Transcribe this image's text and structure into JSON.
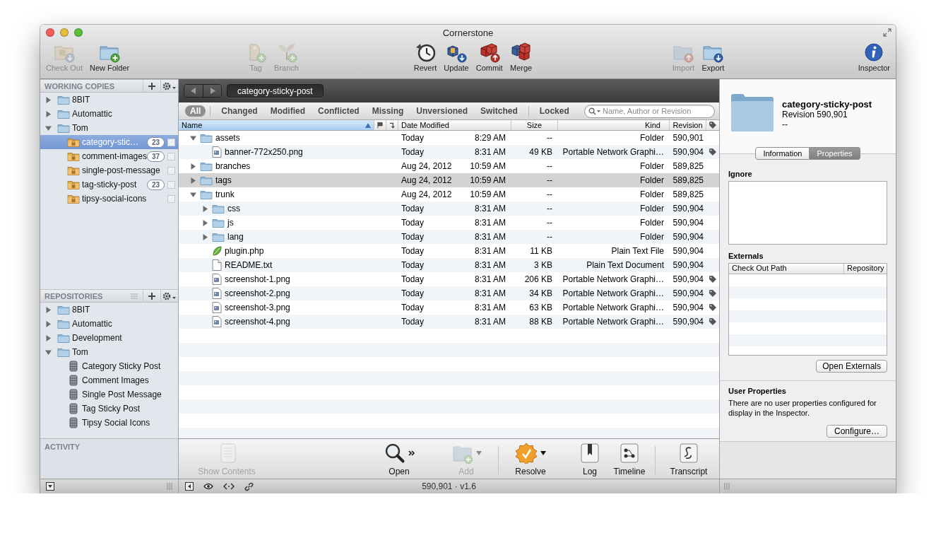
{
  "window": {
    "title": "Cornerstone"
  },
  "toolbar": {
    "groups": [
      [
        {
          "label": "Check Out",
          "kind": "checkout",
          "disabled": true
        },
        {
          "label": "New Folder",
          "kind": "new-folder",
          "disabled": false
        }
      ],
      [
        {
          "label": "Tag",
          "kind": "tag",
          "disabled": true
        },
        {
          "label": "Branch",
          "kind": "branch",
          "disabled": true
        }
      ],
      [
        {
          "label": "Revert",
          "kind": "revert",
          "disabled": false
        },
        {
          "label": "Update",
          "kind": "update",
          "disabled": false
        },
        {
          "label": "Commit",
          "kind": "commit",
          "disabled": false
        },
        {
          "label": "Merge",
          "kind": "merge",
          "disabled": false
        }
      ],
      [
        {
          "label": "Import",
          "kind": "import",
          "disabled": true
        },
        {
          "label": "Export",
          "kind": "export",
          "disabled": false
        }
      ],
      [
        {
          "label": "Inspector",
          "kind": "inspector",
          "disabled": false
        }
      ]
    ]
  },
  "working_copies": {
    "title": "WORKING COPIES",
    "items": [
      {
        "label": "8BIT",
        "kind": "folder",
        "expanded": false,
        "selected": false
      },
      {
        "label": "Automattic",
        "kind": "folder",
        "expanded": false,
        "selected": false
      },
      {
        "label": "Tom",
        "kind": "folder",
        "expanded": true,
        "selected": false,
        "children": [
          {
            "label": "category-stic…",
            "kind": "working-copy",
            "badge": "23",
            "checked": false,
            "selected": true
          },
          {
            "label": "comment-images",
            "kind": "working-copy",
            "badge": "37",
            "checked": false,
            "selected": false
          },
          {
            "label": "single-post-message",
            "kind": "working-copy",
            "checked": false,
            "selected": false
          },
          {
            "label": "tag-sticky-post",
            "kind": "working-copy",
            "badge": "23",
            "checked": false,
            "selected": false
          },
          {
            "label": "tipsy-social-icons",
            "kind": "working-copy",
            "checked": false,
            "selected": false
          }
        ]
      }
    ]
  },
  "repositories": {
    "title": "REPOSITORIES",
    "items": [
      {
        "label": "8BIT",
        "kind": "folder",
        "expanded": false,
        "selected": false
      },
      {
        "label": "Automattic",
        "kind": "folder",
        "expanded": false,
        "selected": false
      },
      {
        "label": "Development",
        "kind": "folder",
        "expanded": false,
        "selected": false
      },
      {
        "label": "Tom",
        "kind": "folder",
        "expanded": true,
        "selected": false,
        "children": [
          {
            "label": "Category Sticky Post",
            "kind": "repository",
            "selected": false
          },
          {
            "label": "Comment Images",
            "kind": "repository",
            "selected": false
          },
          {
            "label": "Single Post Message",
            "kind": "repository",
            "selected": false
          },
          {
            "label": "Tag Sticky Post",
            "kind": "repository",
            "selected": false
          },
          {
            "label": "Tipsy Social Icons",
            "kind": "repository",
            "selected": false
          }
        ]
      }
    ]
  },
  "activity": {
    "title": "ACTIVITY"
  },
  "browser": {
    "path": "category-sticky-post",
    "filters": [
      {
        "label": "All",
        "selected": true
      },
      {
        "label": "Changed",
        "selected": false
      },
      {
        "label": "Modified",
        "selected": false
      },
      {
        "label": "Conflicted",
        "selected": false
      },
      {
        "label": "Missing",
        "selected": false
      },
      {
        "label": "Unversioned",
        "selected": false
      },
      {
        "label": "Switched",
        "selected": false
      },
      {
        "label": "Locked",
        "selected": false
      }
    ],
    "search": {
      "placeholder": "Name, Author or Revision"
    },
    "columns": [
      {
        "kind": "text",
        "label": "Name",
        "sorted": true
      },
      {
        "kind": "flag",
        "sorted": false
      },
      {
        "kind": "arrow",
        "sorted": false
      },
      {
        "kind": "text",
        "label": "Date Modified",
        "sorted": false
      },
      {
        "kind": "text",
        "label": "Size",
        "sorted": false
      },
      {
        "kind": "text",
        "label": "Kind",
        "sorted": false
      },
      {
        "kind": "text",
        "label": "Revision",
        "sorted": false
      },
      {
        "kind": "tag",
        "sorted": false
      }
    ],
    "rows": [
      {
        "name": "assets",
        "kind": "folder",
        "expanded": true,
        "selected": false,
        "date": "Today",
        "time": "8:29 AM",
        "size": "--",
        "file_kind": "Folder",
        "revision": "590,901",
        "tagged": false,
        "children": [
          {
            "name": "banner-772x250.png",
            "kind": "image",
            "selected": false,
            "date": "Today",
            "time": "8:31 AM",
            "size": "49 KB",
            "file_kind": "Portable Network Graphi…",
            "revision": "590,904",
            "tagged": true
          }
        ]
      },
      {
        "name": "branches",
        "kind": "folder",
        "expanded": false,
        "selected": false,
        "date": "Aug 24, 2012",
        "time": "10:59 AM",
        "size": "--",
        "file_kind": "Folder",
        "revision": "589,825",
        "tagged": false
      },
      {
        "name": "tags",
        "kind": "folder",
        "expanded": false,
        "selected": true,
        "date": "Aug 24, 2012",
        "time": "10:59 AM",
        "size": "--",
        "file_kind": "Folder",
        "revision": "589,825",
        "tagged": false
      },
      {
        "name": "trunk",
        "kind": "folder",
        "expanded": true,
        "selected": false,
        "date": "Aug 24, 2012",
        "time": "10:59 AM",
        "size": "--",
        "file_kind": "Folder",
        "revision": "589,825",
        "tagged": false,
        "children": [
          {
            "name": "css",
            "kind": "folder",
            "expanded": false,
            "selected": false,
            "date": "Today",
            "time": "8:31 AM",
            "size": "--",
            "file_kind": "Folder",
            "revision": "590,904",
            "tagged": false
          },
          {
            "name": "js",
            "kind": "folder",
            "expanded": false,
            "selected": false,
            "date": "Today",
            "time": "8:31 AM",
            "size": "--",
            "file_kind": "Folder",
            "revision": "590,904",
            "tagged": false
          },
          {
            "name": "lang",
            "kind": "folder",
            "expanded": false,
            "selected": false,
            "date": "Today",
            "time": "8:31 AM",
            "size": "--",
            "file_kind": "Folder",
            "revision": "590,904",
            "tagged": false
          },
          {
            "name": "plugin.php",
            "kind": "php",
            "selected": false,
            "date": "Today",
            "time": "8:31 AM",
            "size": "11 KB",
            "file_kind": "Plain Text File",
            "revision": "590,904",
            "tagged": false
          },
          {
            "name": "README.txt",
            "kind": "text",
            "selected": false,
            "date": "Today",
            "time": "8:31 AM",
            "size": "3 KB",
            "file_kind": "Plain Text Document",
            "revision": "590,904",
            "tagged": false
          },
          {
            "name": "screenshot-1.png",
            "kind": "image",
            "selected": false,
            "date": "Today",
            "time": "8:31 AM",
            "size": "206 KB",
            "file_kind": "Portable Network Graphi…",
            "revision": "590,904",
            "tagged": true
          },
          {
            "name": "screenshot-2.png",
            "kind": "image",
            "selected": false,
            "date": "Today",
            "time": "8:31 AM",
            "size": "34 KB",
            "file_kind": "Portable Network Graphi…",
            "revision": "590,904",
            "tagged": true
          },
          {
            "name": "screenshot-3.png",
            "kind": "image",
            "selected": false,
            "date": "Today",
            "time": "8:31 AM",
            "size": "63 KB",
            "file_kind": "Portable Network Graphi…",
            "revision": "590,904",
            "tagged": true
          },
          {
            "name": "screenshot-4.png",
            "kind": "image",
            "selected": false,
            "date": "Today",
            "time": "8:31 AM",
            "size": "88 KB",
            "file_kind": "Portable Network Graphi…",
            "revision": "590,904",
            "tagged": true
          }
        ]
      }
    ]
  },
  "actions": [
    {
      "label": "Show Contents",
      "kind": "contents",
      "disabled": true
    },
    {
      "label": "Open",
      "kind": "open",
      "disabled": false
    },
    {
      "label": "Add",
      "kind": "add",
      "disabled": true
    },
    {
      "label": "Resolve",
      "kind": "resolve",
      "disabled": false
    },
    {
      "label": "Log",
      "kind": "log",
      "disabled": false
    },
    {
      "label": "Timeline",
      "kind": "timeline",
      "disabled": false
    },
    {
      "label": "Transcript",
      "kind": "transcript",
      "disabled": false
    }
  ],
  "inspector": {
    "title": "category-sticky-post",
    "revision": "Revision 590,901",
    "author": "--",
    "tabs": [
      {
        "label": "Information",
        "selected": false
      },
      {
        "label": "Properties",
        "selected": true
      }
    ],
    "ignore": {
      "label": "Ignore"
    },
    "externals": {
      "label": "Externals",
      "columns": [
        "Check Out Path",
        "Repository"
      ],
      "button": "Open Externals"
    },
    "user_properties": {
      "title": "User Properties",
      "text": "There are no user properties configured for display in the Inspector.",
      "button": "Configure…"
    }
  },
  "status_bar": {
    "text": "590,901 · v1.6"
  }
}
